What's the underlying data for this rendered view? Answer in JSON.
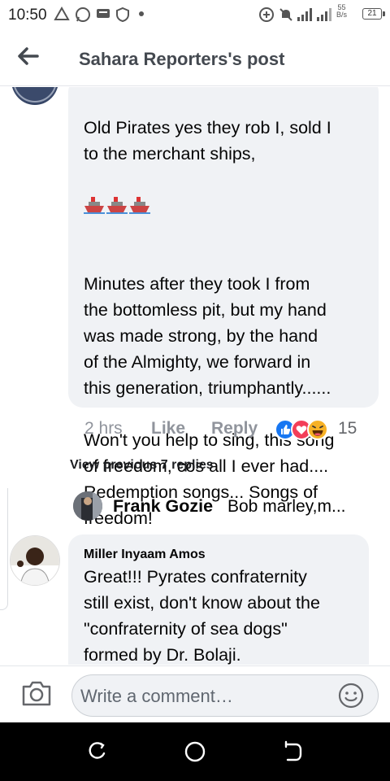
{
  "status_bar": {
    "time": "10:50",
    "net_speed_value": "55",
    "net_speed_unit": "B/s",
    "battery": "21",
    "icons": [
      "warning-icon",
      "whatsapp-icon",
      "message-icon",
      "shield-icon",
      "dot-icon",
      "data-saver-icon",
      "mute-icon",
      "signal-icon",
      "signal-icon",
      "battery-icon"
    ]
  },
  "header": {
    "title": "Sahara Reporters's post",
    "back_icon": "back-arrow-icon"
  },
  "comment_main": {
    "lines_before_ships": "Old Pirates yes they rob I, sold I\nto the merchant ships,",
    "emoji": "ship-emoji",
    "lines_after_ships": "Minutes after they took I from\nthe bottomless pit, but my hand\nwas made strong, by the hand\nof the Almighty, we forward in\nthis generation, triumphantly......\n\nWon't you help to sing, this song\nof freedom, cos all I ever had....\n Redemption songs...  Songs of\nfreedom!",
    "time": "2 hrs",
    "like_label": "Like",
    "reply_label": "Reply",
    "reactions": [
      "like-reaction-icon",
      "love-reaction-icon",
      "haha-reaction-icon"
    ],
    "reaction_count": "15"
  },
  "view_previous": "View previous 7 replies",
  "reply_preview": {
    "author": "Frank Gozie",
    "text": "Bob marley,m..."
  },
  "comment_reply": {
    "author": "Miller Inyaam Amos",
    "text": "Great!!! Pyrates confraternity\nstill exist, don't know about the\n\"confraternity of sea dogs\"\nformed by Dr. Bolaji."
  },
  "composer": {
    "placeholder": "Write a comment…"
  },
  "colors": {
    "bubble": "#f0f2f5",
    "meta": "#90949c",
    "like_blue": "#1877f2",
    "love_red": "#f33e58",
    "haha_yellow": "#f7b125"
  }
}
